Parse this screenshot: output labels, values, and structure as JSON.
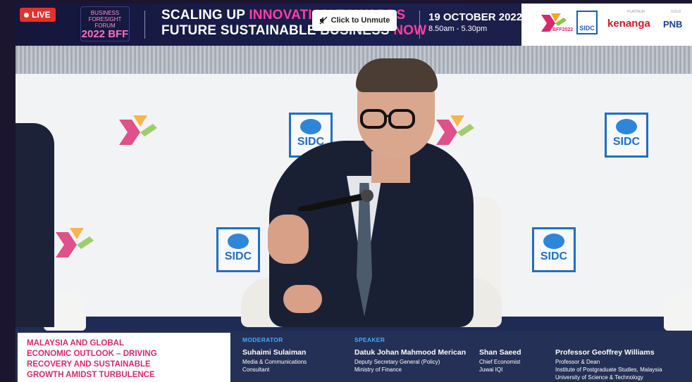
{
  "top_banner": {
    "live_label": "LIVE",
    "forum_logo": {
      "line1": "BUSINESS",
      "line2": "FORESIGHT",
      "line3": "FORUM",
      "year": "2022",
      "abbr": "BFF"
    },
    "headline_line1_white": "SCALING UP ",
    "headline_line1_pink": "INNOVATION TOWARDS",
    "headline_line2_white": "FUTURE SUSTAINABLE BUSINESS ",
    "headline_line2_pink": "NOW",
    "unmute_button": "Click to Unmute",
    "date": "19 OCTOBER 2022",
    "time": "8.50am - 5.30pm",
    "sponsors": {
      "bff": "BFF2022",
      "sidc": "SIDC",
      "platinum_label": "PLATINUM",
      "gold_label": "GOLD",
      "kenanga": "kenanga",
      "pnb": "PNB"
    }
  },
  "stage": {
    "backdrop_logos": {
      "sidc": "SIDC",
      "bff": "BFF2022"
    }
  },
  "lower_third": {
    "session_title": "MALAYSIA AND GLOBAL\nECONOMIC OUTLOOK – DRIVING\nRECOVERY AND SUSTAINABLE\nGROWTH AMIDST TURBULENCE",
    "moderator_label": "MODERATOR",
    "moderator": {
      "name": "Suhaimi Sulaiman",
      "role": "Media & Communications\nConsultant"
    },
    "speaker_label": "SPEAKER",
    "speakers": [
      {
        "name": "Datuk Johan Mahmood Merican",
        "role": "Deputy Secretary General (Policy)\nMinistry of Finance"
      },
      {
        "name": "Shan Saeed",
        "role": "Chief Economist\nJuwai IQI"
      },
      {
        "name": "Professor Geoffrey Williams",
        "role": "Professor & Dean\nInstitute of Postgraduate Studies, Malaysia\nUniversity of Science & Technology"
      }
    ]
  },
  "colors": {
    "accent_pink": "#ff3fa0",
    "title_pink": "#d8286f",
    "navy": "#243056",
    "live_red": "#e3312b",
    "label_blue": "#48a8ff"
  }
}
